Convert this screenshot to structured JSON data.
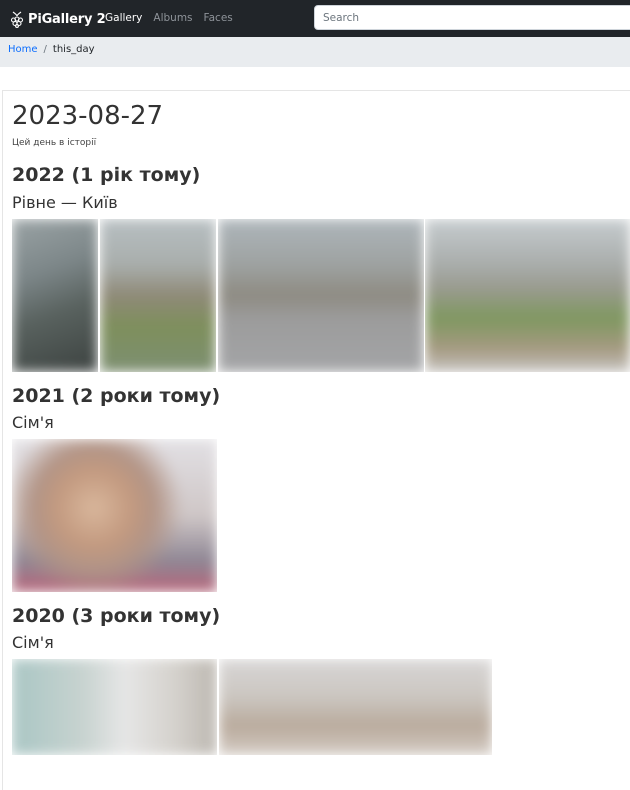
{
  "navbar": {
    "brand": "PiGallery 2",
    "links": [
      "Gallery",
      "Albums",
      "Faces"
    ],
    "search_placeholder": "Search"
  },
  "breadcrumb": {
    "home": "Home",
    "separator": "/",
    "current": "this_day"
  },
  "page": {
    "title": "2023-08-27",
    "subtitle": "Цей день в історії"
  },
  "sections": [
    {
      "year_label": "2022 (1 рік тому)",
      "album": "Рівне — Київ",
      "photo_count": 4
    },
    {
      "year_label": "2021 (2 роки тому)",
      "album": "Сім'я",
      "photo_count": 1
    },
    {
      "year_label": "2020 (3 роки тому)",
      "album": "Сім'я",
      "photo_count": 2
    }
  ],
  "colors": {
    "navbar_bg": "#212529",
    "breadcrumb_bg": "#e9ecef",
    "link": "#0d6efd"
  }
}
